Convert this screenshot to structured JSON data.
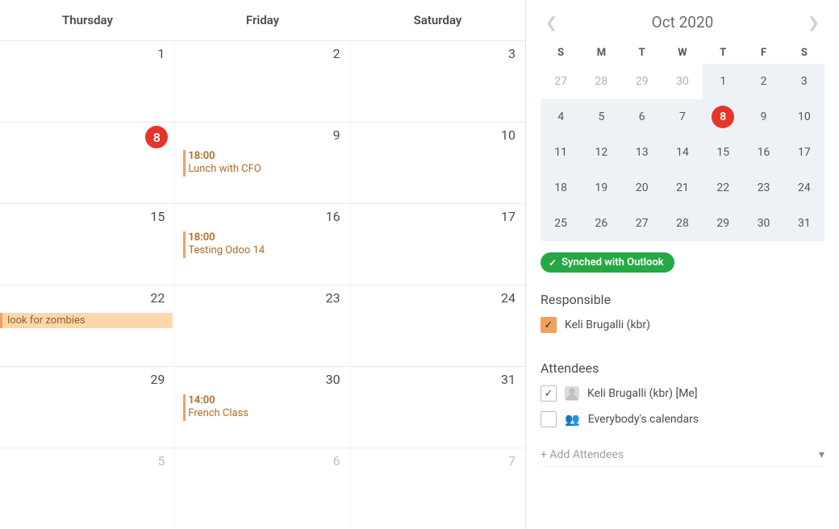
{
  "main_calendar": {
    "day_headers": [
      "Thursday",
      "Friday",
      "Saturday"
    ],
    "rows": [
      {
        "cells": [
          {
            "date": "1"
          },
          {
            "date": "2"
          },
          {
            "date": "3"
          }
        ]
      },
      {
        "cells": [
          {
            "date": "8",
            "today": true
          },
          {
            "date": "9",
            "timed_event": {
              "time": "18:00",
              "title": "Lunch with CFO"
            }
          },
          {
            "date": "10"
          }
        ]
      },
      {
        "cells": [
          {
            "date": "15"
          },
          {
            "date": "16",
            "timed_event": {
              "time": "18:00",
              "title": "Testing Odoo 14"
            }
          },
          {
            "date": "17"
          }
        ]
      },
      {
        "cells": [
          {
            "date": "22",
            "allday_event": {
              "title": "look for zombies"
            }
          },
          {
            "date": "23"
          },
          {
            "date": "24"
          }
        ]
      },
      {
        "cells": [
          {
            "date": "29"
          },
          {
            "date": "30",
            "timed_event": {
              "time": "14:00",
              "title": "French Class"
            }
          },
          {
            "date": "31"
          }
        ]
      },
      {
        "cells": [
          {
            "date": "5",
            "muted": true
          },
          {
            "date": "6",
            "muted": true
          },
          {
            "date": "7",
            "muted": true
          }
        ]
      }
    ]
  },
  "mini": {
    "title": "Oct 2020",
    "dow": [
      "S",
      "M",
      "T",
      "W",
      "T",
      "F",
      "S"
    ],
    "weeks": [
      [
        {
          "n": "27",
          "prev": true
        },
        {
          "n": "28",
          "prev": true
        },
        {
          "n": "29",
          "prev": true
        },
        {
          "n": "30",
          "prev": true
        },
        {
          "n": "1",
          "cm": true
        },
        {
          "n": "2",
          "cm": true
        },
        {
          "n": "3",
          "cm": true
        }
      ],
      [
        {
          "n": "4",
          "cm": true
        },
        {
          "n": "5",
          "cm": true
        },
        {
          "n": "6",
          "cm": true
        },
        {
          "n": "7",
          "cm": true
        },
        {
          "n": "8",
          "cm": true,
          "today": true
        },
        {
          "n": "9",
          "cm": true
        },
        {
          "n": "10",
          "cm": true
        }
      ],
      [
        {
          "n": "11",
          "cm": true
        },
        {
          "n": "12",
          "cm": true
        },
        {
          "n": "13",
          "cm": true
        },
        {
          "n": "14",
          "cm": true
        },
        {
          "n": "15",
          "cm": true
        },
        {
          "n": "16",
          "cm": true
        },
        {
          "n": "17",
          "cm": true
        }
      ],
      [
        {
          "n": "18",
          "cm": true
        },
        {
          "n": "19",
          "cm": true
        },
        {
          "n": "20",
          "cm": true
        },
        {
          "n": "21",
          "cm": true
        },
        {
          "n": "22",
          "cm": true
        },
        {
          "n": "23",
          "cm": true
        },
        {
          "n": "24",
          "cm": true
        }
      ],
      [
        {
          "n": "25",
          "cm": true
        },
        {
          "n": "26",
          "cm": true
        },
        {
          "n": "27",
          "cm": true
        },
        {
          "n": "28",
          "cm": true
        },
        {
          "n": "29",
          "cm": true
        },
        {
          "n": "30",
          "cm": true
        },
        {
          "n": "31",
          "cm": true
        }
      ]
    ]
  },
  "sync_label": "Synched with Outlook",
  "responsible": {
    "title": "Responsible",
    "name": "Keli Brugalli (kbr)"
  },
  "attendees": {
    "title": "Attendees",
    "items": [
      {
        "checked": true,
        "icon": "avatar",
        "label": "Keli Brugalli (kbr) [Me]"
      },
      {
        "checked": false,
        "icon": "group",
        "label": "Everybody's calendars"
      }
    ],
    "add_placeholder": "+ Add Attendees"
  }
}
